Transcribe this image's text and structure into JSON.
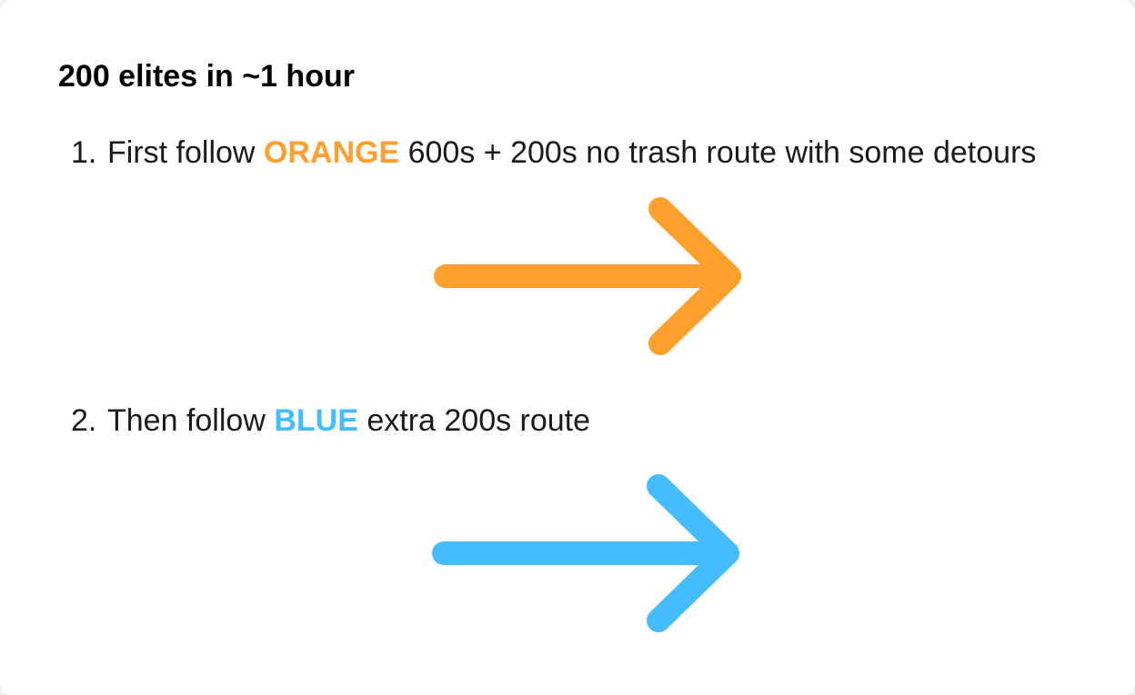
{
  "title": "200 elites in ~1 hour",
  "steps": [
    {
      "number": "1.",
      "prefix": "First follow ",
      "highlight": "ORANGE",
      "suffix": " 600s + 200s no trash route with some detours",
      "color": "#ff9f2e",
      "icon": "arrow-right-icon"
    },
    {
      "number": "2.",
      "prefix": "Then follow ",
      "highlight": "BLUE",
      "suffix": " extra 200s route",
      "color": "#45bcff",
      "icon": "arrow-right-icon"
    }
  ],
  "colors": {
    "background": "#ffffff",
    "orange": "#ff9f2e",
    "blue": "#45bcff"
  }
}
